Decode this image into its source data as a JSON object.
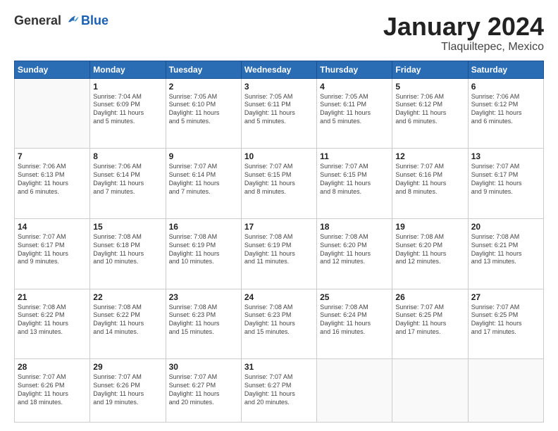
{
  "logo": {
    "general": "General",
    "blue": "Blue"
  },
  "title": {
    "month": "January 2024",
    "location": "Tlaquiltepec, Mexico"
  },
  "weekdays": [
    "Sunday",
    "Monday",
    "Tuesday",
    "Wednesday",
    "Thursday",
    "Friday",
    "Saturday"
  ],
  "weeks": [
    [
      {
        "day": "",
        "info": ""
      },
      {
        "day": "1",
        "info": "Sunrise: 7:04 AM\nSunset: 6:09 PM\nDaylight: 11 hours\nand 5 minutes."
      },
      {
        "day": "2",
        "info": "Sunrise: 7:05 AM\nSunset: 6:10 PM\nDaylight: 11 hours\nand 5 minutes."
      },
      {
        "day": "3",
        "info": "Sunrise: 7:05 AM\nSunset: 6:11 PM\nDaylight: 11 hours\nand 5 minutes."
      },
      {
        "day": "4",
        "info": "Sunrise: 7:05 AM\nSunset: 6:11 PM\nDaylight: 11 hours\nand 5 minutes."
      },
      {
        "day": "5",
        "info": "Sunrise: 7:06 AM\nSunset: 6:12 PM\nDaylight: 11 hours\nand 6 minutes."
      },
      {
        "day": "6",
        "info": "Sunrise: 7:06 AM\nSunset: 6:12 PM\nDaylight: 11 hours\nand 6 minutes."
      }
    ],
    [
      {
        "day": "7",
        "info": "Sunrise: 7:06 AM\nSunset: 6:13 PM\nDaylight: 11 hours\nand 6 minutes."
      },
      {
        "day": "8",
        "info": "Sunrise: 7:06 AM\nSunset: 6:14 PM\nDaylight: 11 hours\nand 7 minutes."
      },
      {
        "day": "9",
        "info": "Sunrise: 7:07 AM\nSunset: 6:14 PM\nDaylight: 11 hours\nand 7 minutes."
      },
      {
        "day": "10",
        "info": "Sunrise: 7:07 AM\nSunset: 6:15 PM\nDaylight: 11 hours\nand 8 minutes."
      },
      {
        "day": "11",
        "info": "Sunrise: 7:07 AM\nSunset: 6:15 PM\nDaylight: 11 hours\nand 8 minutes."
      },
      {
        "day": "12",
        "info": "Sunrise: 7:07 AM\nSunset: 6:16 PM\nDaylight: 11 hours\nand 8 minutes."
      },
      {
        "day": "13",
        "info": "Sunrise: 7:07 AM\nSunset: 6:17 PM\nDaylight: 11 hours\nand 9 minutes."
      }
    ],
    [
      {
        "day": "14",
        "info": "Sunrise: 7:07 AM\nSunset: 6:17 PM\nDaylight: 11 hours\nand 9 minutes."
      },
      {
        "day": "15",
        "info": "Sunrise: 7:08 AM\nSunset: 6:18 PM\nDaylight: 11 hours\nand 10 minutes."
      },
      {
        "day": "16",
        "info": "Sunrise: 7:08 AM\nSunset: 6:19 PM\nDaylight: 11 hours\nand 10 minutes."
      },
      {
        "day": "17",
        "info": "Sunrise: 7:08 AM\nSunset: 6:19 PM\nDaylight: 11 hours\nand 11 minutes."
      },
      {
        "day": "18",
        "info": "Sunrise: 7:08 AM\nSunset: 6:20 PM\nDaylight: 11 hours\nand 12 minutes."
      },
      {
        "day": "19",
        "info": "Sunrise: 7:08 AM\nSunset: 6:20 PM\nDaylight: 11 hours\nand 12 minutes."
      },
      {
        "day": "20",
        "info": "Sunrise: 7:08 AM\nSunset: 6:21 PM\nDaylight: 11 hours\nand 13 minutes."
      }
    ],
    [
      {
        "day": "21",
        "info": "Sunrise: 7:08 AM\nSunset: 6:22 PM\nDaylight: 11 hours\nand 13 minutes."
      },
      {
        "day": "22",
        "info": "Sunrise: 7:08 AM\nSunset: 6:22 PM\nDaylight: 11 hours\nand 14 minutes."
      },
      {
        "day": "23",
        "info": "Sunrise: 7:08 AM\nSunset: 6:23 PM\nDaylight: 11 hours\nand 15 minutes."
      },
      {
        "day": "24",
        "info": "Sunrise: 7:08 AM\nSunset: 6:23 PM\nDaylight: 11 hours\nand 15 minutes."
      },
      {
        "day": "25",
        "info": "Sunrise: 7:08 AM\nSunset: 6:24 PM\nDaylight: 11 hours\nand 16 minutes."
      },
      {
        "day": "26",
        "info": "Sunrise: 7:07 AM\nSunset: 6:25 PM\nDaylight: 11 hours\nand 17 minutes."
      },
      {
        "day": "27",
        "info": "Sunrise: 7:07 AM\nSunset: 6:25 PM\nDaylight: 11 hours\nand 17 minutes."
      }
    ],
    [
      {
        "day": "28",
        "info": "Sunrise: 7:07 AM\nSunset: 6:26 PM\nDaylight: 11 hours\nand 18 minutes."
      },
      {
        "day": "29",
        "info": "Sunrise: 7:07 AM\nSunset: 6:26 PM\nDaylight: 11 hours\nand 19 minutes."
      },
      {
        "day": "30",
        "info": "Sunrise: 7:07 AM\nSunset: 6:27 PM\nDaylight: 11 hours\nand 20 minutes."
      },
      {
        "day": "31",
        "info": "Sunrise: 7:07 AM\nSunset: 6:27 PM\nDaylight: 11 hours\nand 20 minutes."
      },
      {
        "day": "",
        "info": ""
      },
      {
        "day": "",
        "info": ""
      },
      {
        "day": "",
        "info": ""
      }
    ]
  ]
}
